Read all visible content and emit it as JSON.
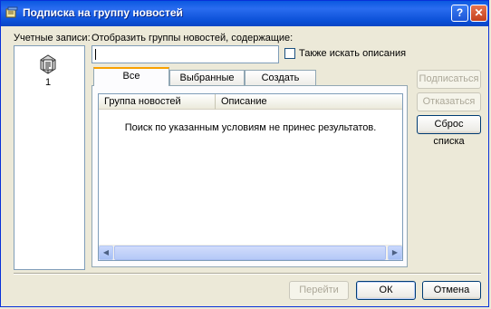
{
  "window": {
    "title": "Подписка на группу новостей",
    "help_label": "?",
    "close_label": "✕"
  },
  "accounts": {
    "label": "Учетные записи:",
    "items": [
      {
        "label": "1",
        "icon": "news-server-icon"
      }
    ]
  },
  "filter": {
    "label": "Отобразить группы новостей, содержащие:",
    "value": ""
  },
  "search_descriptions": {
    "label": "Также искать описания",
    "checked": false
  },
  "tabs": [
    {
      "label": "Все",
      "active": true
    },
    {
      "label": "Выбранные",
      "active": false
    },
    {
      "label": "Создать",
      "active": false
    }
  ],
  "list": {
    "columns": [
      "Группа новостей",
      "Описание"
    ],
    "empty_message": "Поиск по указанным условиям не принес результатов."
  },
  "side_buttons": {
    "subscribe": "Подписаться",
    "unsubscribe": "Отказаться",
    "reset": "Сброс списка"
  },
  "footer": {
    "goto": "Перейти",
    "ok": "ОК",
    "cancel": "Отмена"
  }
}
